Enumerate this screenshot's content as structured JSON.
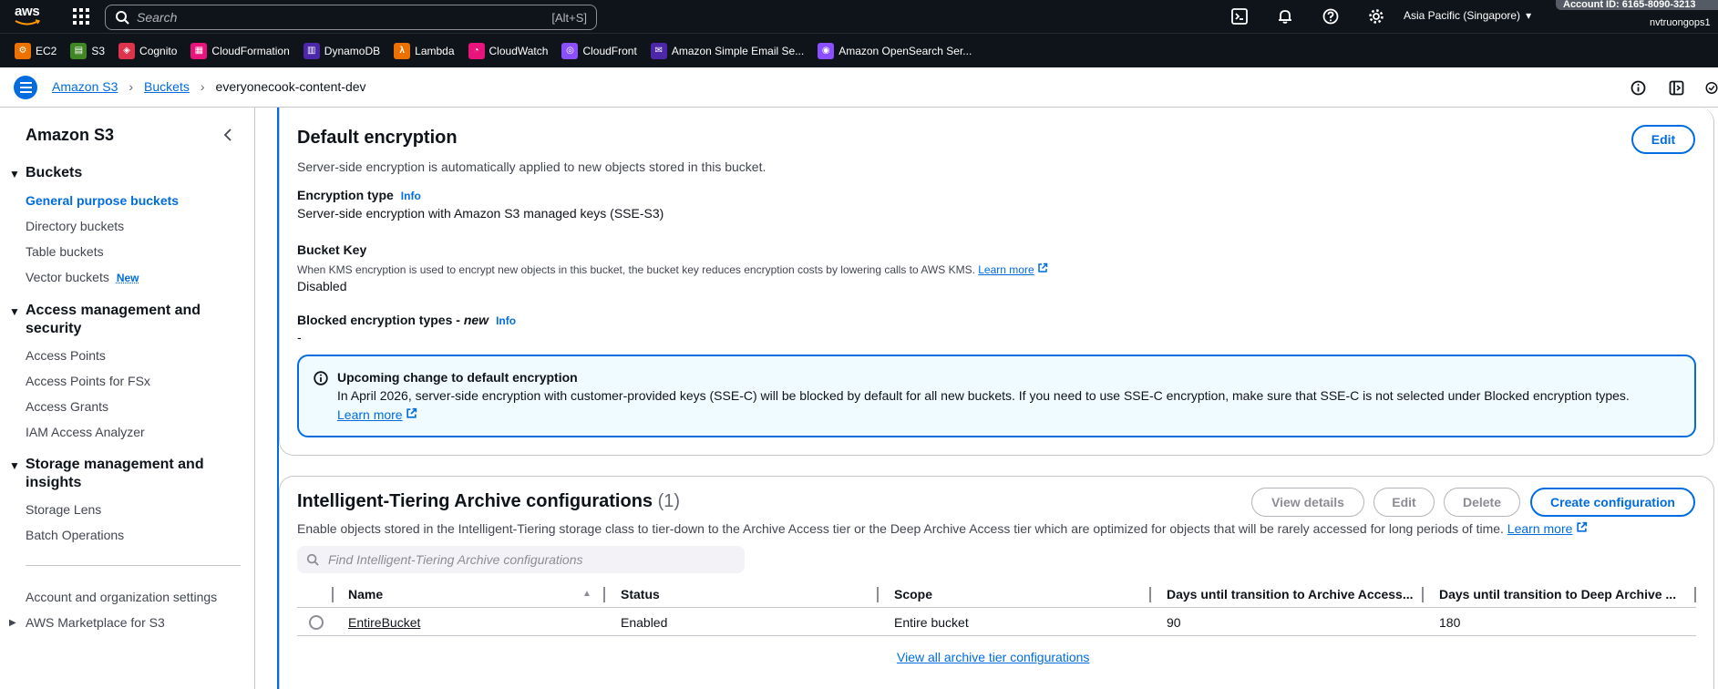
{
  "topnav": {
    "logo_text": "aws",
    "search_placeholder": "Search",
    "search_shortcut": "[Alt+S]",
    "icons": [
      "cloudshell-icon",
      "bell-icon",
      "help-icon",
      "gear-icon"
    ],
    "region": "Asia Pacific (Singapore)",
    "account_id": "Account ID: 6165-8090-3213",
    "username": "nvtruongops1"
  },
  "favorites": [
    {
      "label": "EC2",
      "color": "#ed7100"
    },
    {
      "label": "S3",
      "color": "#3f8624"
    },
    {
      "label": "Cognito",
      "color": "#dd344c"
    },
    {
      "label": "CloudFormation",
      "color": "#e7157b"
    },
    {
      "label": "DynamoDB",
      "color": "#4d27aa"
    },
    {
      "label": "Lambda",
      "color": "#ed7100"
    },
    {
      "label": "CloudWatch",
      "color": "#e7157b"
    },
    {
      "label": "CloudFront",
      "color": "#8c4fff"
    },
    {
      "label": "Amazon Simple Email Se...",
      "color": "#4d27aa"
    },
    {
      "label": "Amazon OpenSearch Ser...",
      "color": "#8c4fff"
    }
  ],
  "breadcrumb": {
    "items": [
      "Amazon S3",
      "Buckets"
    ],
    "current": "everyonecook-content-dev"
  },
  "sidebar": {
    "title": "Amazon S3",
    "sections": [
      {
        "label": "Buckets"
      },
      {
        "label": "Access management and security"
      },
      {
        "label": "Storage management and insights"
      }
    ],
    "items": {
      "general": "General purpose buckets",
      "directory": "Directory buckets",
      "table": "Table buckets",
      "vector": "Vector buckets",
      "vector_badge": "New",
      "access_points": "Access Points",
      "access_points_fsx": "Access Points for FSx",
      "access_grants": "Access Grants",
      "iam_analyzer": "IAM Access Analyzer",
      "storage_lens": "Storage Lens",
      "batch_ops": "Batch Operations",
      "account_settings": "Account and organization settings",
      "marketplace": "AWS Marketplace for S3"
    }
  },
  "encryption": {
    "title": "Default encryption",
    "edit_label": "Edit",
    "description": "Server-side encryption is automatically applied to new objects stored in this bucket.",
    "type_label": "Encryption type",
    "info": "Info",
    "type_value": "Server-side encryption with Amazon S3 managed keys (SSE-S3)",
    "bucket_key_label": "Bucket Key",
    "bucket_key_desc": "When KMS encryption is used to encrypt new objects in this bucket, the bucket key reduces encryption costs by lowering calls to AWS KMS.",
    "learn_more": "Learn more",
    "bucket_key_value": "Disabled",
    "blocked_label": "Blocked encryption types -",
    "blocked_new": "new",
    "blocked_value": "-",
    "alert": {
      "title": "Upcoming change to default encryption",
      "body": "In April 2026, server-side encryption with customer-provided keys (SSE-C) will be blocked by default for all new buckets. If you need to use SSE-C encryption, make sure that SSE-C is not selected under Blocked encryption types.",
      "link": "Learn more"
    }
  },
  "tiering": {
    "title": "Intelligent-Tiering Archive configurations",
    "count": "(1)",
    "buttons": {
      "view_details": "View details",
      "edit": "Edit",
      "delete": "Delete",
      "create": "Create configuration"
    },
    "description": "Enable objects stored in the Intelligent-Tiering storage class to tier-down to the Archive Access tier or the Deep Archive Access tier which are optimized for objects that will be rarely accessed for long periods of time.",
    "learn_more": "Learn more",
    "filter_placeholder": "Find Intelligent-Tiering Archive configurations",
    "columns": [
      "Name",
      "Status",
      "Scope",
      "Days until transition to Archive Access...",
      "Days until transition to Deep Archive ..."
    ],
    "rows": [
      {
        "name": "EntireBucket",
        "status": "Enabled",
        "scope": "Entire bucket",
        "archive_days": "90",
        "deep_archive_days": "180"
      }
    ],
    "view_all": "View all archive tier configurations"
  }
}
